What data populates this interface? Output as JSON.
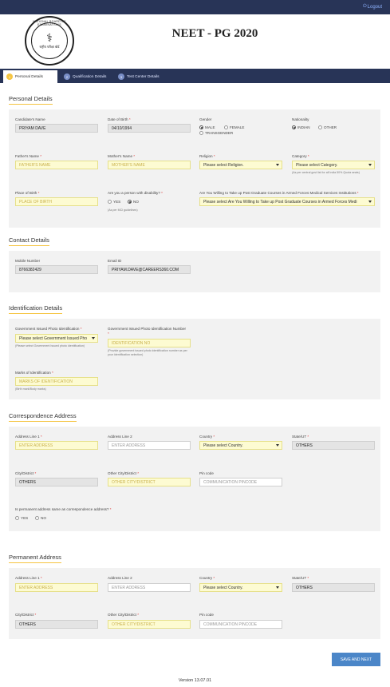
{
  "topbar": {
    "logout_label": "Logout"
  },
  "header": {
    "title": "NEET - PG 2020",
    "logo_text": "NATIONAL BOARD OF EXAMINATIONS",
    "logo_hindi": "राष्ट्रीय परीक्षा बोर्ड"
  },
  "tabs": [
    {
      "num": "1",
      "label": "Personal Details"
    },
    {
      "num": "2",
      "label": "Qualification Details"
    },
    {
      "num": "3",
      "label": "Test Center Details"
    }
  ],
  "personal": {
    "section_title": "Personal Details",
    "candidate_name_label": "Candidate's Name",
    "candidate_name_value": "PRIYAM DAVE",
    "dob_label": "Date of Birth",
    "dob_value": "04/10/1994",
    "gender_label": "Gender",
    "gender_male": "MALE",
    "gender_female": "FEMALE",
    "gender_trans": "TRANSGENDER",
    "nationality_label": "Nationality",
    "nat_indian": "INDIAN",
    "nat_other": "OTHER",
    "father_label": "Father's Name",
    "father_placeholder": "FATHER'S NAME",
    "mother_label": "Mother's Name",
    "mother_placeholder": "MOTHER'S NAME",
    "religion_label": "Religion",
    "religion_value": "Please select Religion.",
    "category_label": "Category",
    "category_value": "Please select Category.",
    "category_hint": "(As per central govt list for all India 50% Quota seats)",
    "pob_label": "Place of Birth",
    "pob_placeholder": "PLACE OF BIRTH",
    "disability_label": "Are you a person with disability?",
    "disability_yes": "YES",
    "disability_no": "NO",
    "disability_hint": "(As per MCI guidelines)",
    "armed_label": "Are You Willing to Take up Post Graduate Courses in Armed Forces Medical Services Institutions",
    "armed_value": "Please select Are You Willing to Take up Post Graduate Courses in Armed Forces Medi"
  },
  "contact": {
    "section_title": "Contact Details",
    "mobile_label": "Mobile Number",
    "mobile_value": "8766382429",
    "email_label": "Email ID",
    "email_value": "PRIYAM.DAVE@CAREERS360.COM"
  },
  "identification": {
    "section_title": "Identification Details",
    "gov_id_label": "Government Issued Photo Identification",
    "gov_id_value": "Please select Government Issued Pho",
    "gov_id_hint": "(Please select Government Issued photo identification)",
    "gov_num_label": "Government Issued Photo Identification Number",
    "gov_num_placeholder": "IDENTIFICATION NO",
    "gov_num_hint": "(Provide government issued photo identification number as per your identification selection)",
    "marks_label": "Marks of Identification",
    "marks_placeholder": "MARKS OF IDENTIFICATION",
    "marks_hint": "(Birth mark/Body marks)"
  },
  "correspondence": {
    "section_title": "Correspondence Address",
    "addr1_label": "Address Line 1",
    "addr1_placeholder": "ENTER ADDRESS",
    "addr2_label": "Address Line 2",
    "addr2_placeholder": "ENTER ADDRESS",
    "country_label": "Country",
    "country_value": "Please select Country.",
    "state_label": "State/UT",
    "state_value": "OTHERS",
    "city_label": "City/District",
    "city_value": "OTHERS",
    "other_city_label": "Other City/District",
    "other_city_placeholder": "OTHER CITY/DISTRICT",
    "pin_label": "Pin code",
    "pin_placeholder": "COMMUNICATION PINCODE",
    "same_label": "Is permanent address same as correspondence address?",
    "same_yes": "YES",
    "same_no": "NO"
  },
  "permanent": {
    "section_title": "Permanent Address",
    "addr1_label": "Address Line 1",
    "addr1_placeholder": "ENTER ADDRESS",
    "addr2_label": "Address Line 2",
    "addr2_placeholder": "ENTER ADDRESS",
    "country_label": "Country",
    "country_value": "Please select Country.",
    "state_label": "State/UT",
    "state_value": "OTHERS",
    "city_label": "City/District",
    "city_value": "OTHERS",
    "other_city_label": "Other City/District",
    "other_city_placeholder": "OTHER CITY/DISTRICT",
    "pin_label": "Pin code",
    "pin_placeholder": "COMMUNICATION PINCODE"
  },
  "footer": {
    "save_next_label": "SAVE AND NEXT",
    "version": "Version 13.07.01"
  },
  "colors": {
    "navy": "#283457",
    "accent": "#f5c542",
    "button": "#4b86c8",
    "field_yellow": "#fdfbd2"
  }
}
